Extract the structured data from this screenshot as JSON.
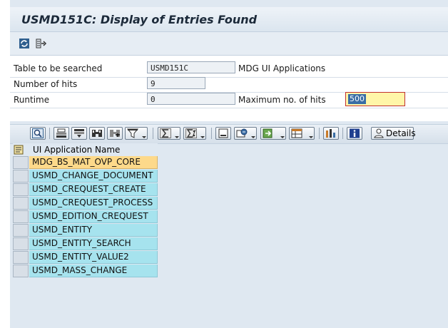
{
  "title": "USMD151C: Display of Entries Found",
  "selection": {
    "table_label": "Table to be searched",
    "table_value": "USMD151C",
    "table_desc": "MDG UI Applications",
    "hits_label": "Number of hits",
    "hits_value": "9",
    "runtime_label": "Runtime",
    "runtime_value": "0",
    "max_label": "Maximum no. of hits",
    "max_value": "500"
  },
  "toolbar": {
    "details_label": "Details",
    "buttons": [
      "refresh-icon",
      "other-list-icon",
      "magnify-icon",
      "sort-ascending-icon",
      "sort-descending-icon",
      "find-icon",
      "find-next-icon",
      "filter-icon",
      "total-icon",
      "subtotal-icon",
      "print-preview-icon",
      "view-icon",
      "export-icon",
      "layout-icon",
      "abc-analysis-icon",
      "info-icon",
      "details-icon"
    ]
  },
  "grid": {
    "column_header": "UI Application Name",
    "rows": [
      "MDG_BS_MAT_OVP_CORE",
      "USMD_CHANGE_DOCUMENT",
      "USMD_CREQUEST_CREATE",
      "USMD_CREQUEST_PROCESS",
      "USMD_EDITION_CREQUEST",
      "USMD_ENTITY",
      "USMD_ENTITY_SEARCH",
      "USMD_ENTITY_VALUE2",
      "USMD_MASS_CHANGE"
    ],
    "highlight_color": "#fdd98a",
    "cell_color": "#a6e3ee"
  }
}
